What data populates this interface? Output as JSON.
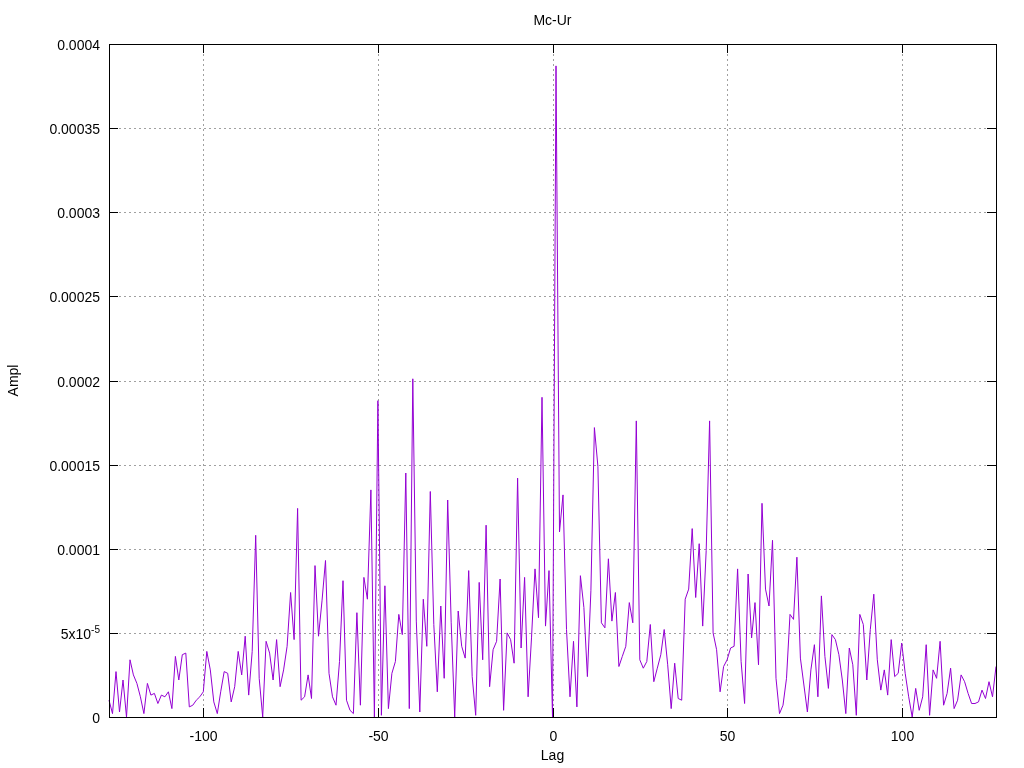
{
  "plot": {
    "chart_data": {
      "type": "line",
      "title": "Mc-Ur",
      "xlabel": "Lag",
      "ylabel": "Ampl",
      "x": [
        -127,
        -126,
        -125,
        -124,
        -123,
        -122,
        -121,
        -120,
        -119,
        -118,
        -117,
        -116,
        -115,
        -114,
        -113,
        -112,
        -111,
        -110,
        -109,
        -108,
        -107,
        -106,
        -105,
        -104,
        -103,
        -102,
        -101,
        -100,
        -99,
        -98,
        -97,
        -96,
        -95,
        -94,
        -93,
        -92,
        -91,
        -90,
        -89,
        -88,
        -87,
        -86,
        -85,
        -84,
        -83,
        -82,
        -81,
        -80,
        -79,
        -78,
        -77,
        -76,
        -75,
        -74,
        -73,
        -72,
        -71,
        -70,
        -69,
        -68,
        -67,
        -66,
        -65,
        -64,
        -63,
        -62,
        -61,
        -60,
        -59,
        -58,
        -57,
        -56,
        -55,
        -54,
        -53,
        -52,
        -51,
        -50,
        -49,
        -48,
        -47,
        -46,
        -45,
        -44,
        -43,
        -42,
        -41,
        -40,
        -39,
        -38,
        -37,
        -36,
        -35,
        -34,
        -33,
        -32,
        -31,
        -30,
        -29,
        -28,
        -27,
        -26,
        -25,
        -24,
        -23,
        -22,
        -21,
        -20,
        -19,
        -18,
        -17,
        -16,
        -15,
        -14,
        -13,
        -12,
        -11,
        -10,
        -9,
        -8,
        -7,
        -6,
        -5,
        -4,
        -3,
        -2,
        -1,
        0,
        1,
        2,
        3,
        4,
        5,
        6,
        7,
        8,
        9,
        10,
        11,
        12,
        13,
        14,
        15,
        16,
        17,
        18,
        19,
        20,
        21,
        22,
        23,
        24,
        25,
        26,
        27,
        28,
        29,
        30,
        31,
        32,
        33,
        34,
        35,
        36,
        37,
        38,
        39,
        40,
        41,
        42,
        43,
        44,
        45,
        46,
        47,
        48,
        49,
        50,
        51,
        52,
        53,
        54,
        55,
        56,
        57,
        58,
        59,
        60,
        61,
        62,
        63,
        64,
        65,
        66,
        67,
        68,
        69,
        70,
        71,
        72,
        73,
        74,
        75,
        76,
        77,
        78,
        79,
        80,
        81,
        82,
        83,
        84,
        85,
        86,
        87,
        88,
        89,
        90,
        91,
        92,
        93,
        94,
        95,
        96,
        97,
        98,
        99,
        100,
        101,
        102,
        103,
        104,
        105,
        106,
        107,
        108,
        109,
        110,
        111,
        112,
        113,
        114,
        115,
        116,
        117,
        118,
        119,
        120,
        121,
        122,
        123,
        124,
        125,
        126,
        127
      ],
      "grid": true,
      "series": [
        {
          "color": "#9400d3",
          "values": [
            1e-05,
            2e-06,
            2.7e-05,
            3e-06,
            2.2e-05,
            0,
            3.4e-05,
            2.5e-05,
            2e-05,
            1.2e-05,
            2e-06,
            2e-05,
            1.3e-05,
            1.4e-05,
            8e-06,
            1.3e-05,
            1.2e-05,
            1.5e-05,
            5e-06,
            3.6e-05,
            2.2e-05,
            3.7e-05,
            3.8e-05,
            6e-06,
            7e-06,
            1e-05,
            1.2e-05,
            1.5e-05,
            3.9e-05,
            2.8e-05,
            9e-06,
            2e-06,
            1.5e-05,
            2.7e-05,
            2.6e-05,
            9e-06,
            1.8e-05,
            3.9e-05,
            2.5e-05,
            4.8e-05,
            1.3e-05,
            3.9e-05,
            0.000108,
            2.3e-05,
            0,
            4.5e-05,
            3.8e-05,
            2.2e-05,
            4.6e-05,
            1.8e-05,
            2.8e-05,
            4.2e-05,
            7.4e-05,
            4.6e-05,
            0.000124,
            1e-05,
            1.2e-05,
            2.5e-05,
            1.1e-05,
            9e-05,
            4.8e-05,
            6.9e-05,
            9.3e-05,
            2.6e-05,
            1.2e-05,
            7e-06,
            3.3e-05,
            8.1e-05,
            1e-05,
            4e-06,
            2e-06,
            6.2e-05,
            7e-06,
            8.3e-05,
            7e-05,
            0.000135,
            0,
            0.000188,
            1e-06,
            7.8e-05,
            5e-06,
            2.6e-05,
            3.3e-05,
            6.1e-05,
            4.9e-05,
            0.000145,
            5e-06,
            0.000201,
            5.7e-05,
            3e-06,
            7e-05,
            4.2e-05,
            0.000134,
            5.5e-05,
            1.5e-05,
            6.6e-05,
            2.3e-05,
            0.000129,
            5.6e-05,
            0,
            6.3e-05,
            4.2e-05,
            3.5e-05,
            8.7e-05,
            2.4e-05,
            1e-06,
            8e-05,
            3.4e-05,
            0.000114,
            1.8e-05,
            4e-05,
            4.5e-05,
            8.2e-05,
            4e-06,
            5e-05,
            4.6e-05,
            3.2e-05,
            0.000142,
            4.1e-05,
            8.3e-05,
            1.2e-05,
            4.7e-05,
            8.8e-05,
            5.9e-05,
            0.00019,
            5.4e-05,
            8.7e-05,
            0,
            0.000387,
            0.00011,
            0.000132,
            5.2e-05,
            1.2e-05,
            4.5e-05,
            6e-06,
            8.4e-05,
            6.5e-05,
            2.4e-05,
            7.5e-05,
            0.000172,
            0.000149,
            5.6e-05,
            5.3e-05,
            9.4e-05,
            5.7e-05,
            7.4e-05,
            3e-05,
            3.6e-05,
            4.2e-05,
            6.8e-05,
            5.6e-05,
            0.000176,
            3.4e-05,
            2.9e-05,
            3.3e-05,
            5.5e-05,
            2.1e-05,
            2.9e-05,
            3.7e-05,
            5.2e-05,
            3.1e-05,
            5e-06,
            3.2e-05,
            1.1e-05,
            1e-05,
            7e-05,
            7.6e-05,
            0.000112,
            7.1e-05,
            0.000103,
            5.4e-05,
            9.9e-05,
            0.000176,
            5e-05,
            4e-05,
            1.5e-05,
            3e-05,
            3.4e-05,
            4.1e-05,
            4.2e-05,
            8.8e-05,
            3.3e-05,
            8e-06,
            8.5e-05,
            4.7e-05,
            6.8e-05,
            3.1e-05,
            0.000127,
            7.6e-05,
            6.6e-05,
            0.000105,
            2.3e-05,
            2e-06,
            7e-06,
            2.3e-05,
            6.1e-05,
            5.8e-05,
            9.5e-05,
            3.5e-05,
            1.9e-05,
            3e-06,
            2.8e-05,
            4.3e-05,
            1.2e-05,
            7.2e-05,
            3.6e-05,
            1.7e-05,
            4.9e-05,
            4.6e-05,
            3.7e-05,
            2.2e-05,
            2e-06,
            4.1e-05,
            3.1e-05,
            1e-06,
            6.1e-05,
            5.5e-05,
            2.2e-05,
            5.2e-05,
            7.3e-05,
            3.4e-05,
            1.6e-05,
            2.8e-05,
            1.3e-05,
            4.6e-05,
            2.4e-05,
            2.6e-05,
            4.4e-05,
            2.6e-05,
            1.2e-05,
            0,
            1.7e-05,
            4e-06,
            1.2e-05,
            4.3e-05,
            1e-06,
            2.8e-05,
            2.3e-05,
            4.5e-05,
            7e-06,
            1.4e-05,
            2.9e-05,
            5e-06,
            1e-05,
            2.5e-05,
            2.1e-05,
            1.4e-05,
            8e-06,
            8e-06,
            9e-06,
            1.6e-05,
            1.1e-05,
            2.1e-05,
            1.2e-05,
            3e-05
          ]
        }
      ],
      "xlim": [
        -127,
        127
      ],
      "ylim": [
        0,
        0.0004
      ],
      "xticks": [
        -100,
        -50,
        0,
        50,
        100
      ],
      "yticks": [
        0,
        {
          "value": 5e-05,
          "label": "5x10$^{-5}$"
        },
        0.0001,
        0.00015,
        0.0002,
        0.00025,
        0.0003,
        0.00035,
        0.0004
      ]
    }
  }
}
